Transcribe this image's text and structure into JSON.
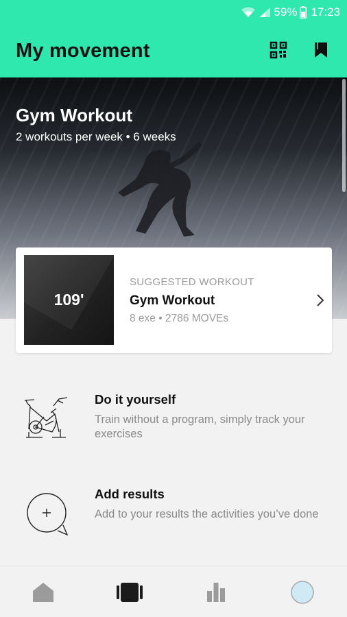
{
  "status_bar": {
    "battery": "59%",
    "time": "17:23"
  },
  "app_bar": {
    "title": "My movement"
  },
  "hero": {
    "title": "Gym Workout",
    "subtitle": "2 workouts per week • 6 weeks"
  },
  "suggested": {
    "duration": "109'",
    "kicker": "SUGGESTED WORKOUT",
    "name": "Gym Workout",
    "meta": "8 exe • 2786 MOVEs"
  },
  "rows": [
    {
      "title": "Do it yourself",
      "description": "Train without a program, simply track your exercises"
    },
    {
      "title": "Add results",
      "description": "Add to your results the activities you’ve done"
    }
  ],
  "bottom_nav": [
    "home",
    "workouts",
    "stats",
    "profile"
  ],
  "colors": {
    "accent": "#2ee8ad",
    "nav_inactive": "#9b9b9b",
    "nav_active": "#1a1a1a",
    "profile": "#cfe9f5"
  }
}
